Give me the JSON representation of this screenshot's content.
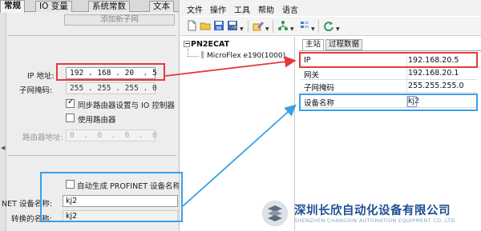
{
  "left_panel": {
    "tabs": [
      "常规",
      "IO 变量",
      "系统常数",
      "文本"
    ],
    "add_subnet_button": "添加新子网",
    "ip_label": "IP 地址:",
    "ip_value": "192 . 168 . 20  . 5",
    "subnet_label": "子网掩码:",
    "subnet_value": "255 . 255 . 255 . 0",
    "sync_router_label": "同步路由器设置与 IO 控制器",
    "sync_router_checked": true,
    "use_router_label": "使用路由器",
    "use_router_checked": false,
    "router_label": "路由器地址:",
    "router_value": "0  .  0  .  0  .  0",
    "auto_generate_label": "自动生成 PROFINET 设备名称",
    "auto_generate_checked": false,
    "device_name_label": "NET 设备名称:",
    "device_name_value": "kj2",
    "converted_name_label": "转换的名称:",
    "converted_name_value": "kj2"
  },
  "right_window": {
    "menu": [
      "文件",
      "操作",
      "工具",
      "帮助",
      "语言"
    ],
    "toolbar_icons": [
      "new-file-icon",
      "open-folder-icon",
      "save-icon",
      "save-as-icon",
      "edit-icon",
      "network-icon",
      "list-icon",
      "refresh-icon"
    ],
    "tree": {
      "root": "PN2ECAT",
      "child": "MicroFlex e190(1000)"
    },
    "property_tabs": [
      "主站",
      "过程数据"
    ],
    "properties": [
      {
        "name": "IP",
        "value": "192.168.20.5"
      },
      {
        "name": "网关",
        "value": "192.168.20.1"
      },
      {
        "name": "子网掩码",
        "value": "255.255.255.0"
      },
      {
        "name": "设备名称",
        "value": "kj2"
      }
    ]
  },
  "logo": {
    "company_cn": "深圳长欣自动化设备有限公司",
    "company_en": "SHENZHEN CHANGXIN AUTOMATION EQUIPMENT CO.,LTD"
  },
  "colors": {
    "highlight_red": "#e53a3a",
    "highlight_blue": "#3aa0e8",
    "logo_blue": "#1f4f93"
  }
}
